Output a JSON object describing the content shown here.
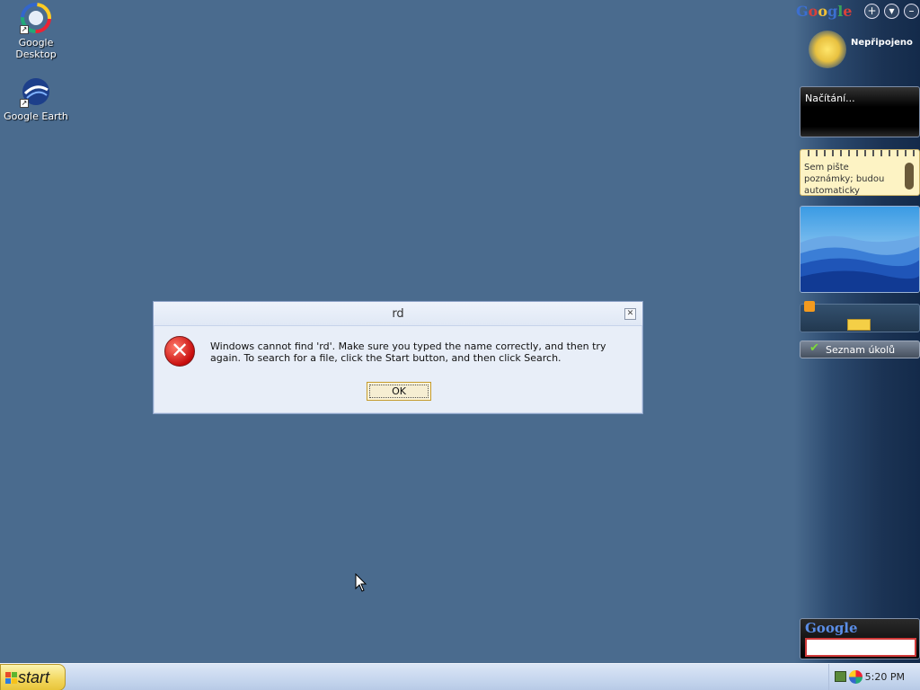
{
  "desktop": {
    "icons": [
      {
        "label_line1": "Google",
        "label_line2": "Desktop",
        "icon": "google-desktop-icon"
      },
      {
        "label_line1": "Google Earth",
        "label_line2": "",
        "icon": "google-earth-icon"
      }
    ]
  },
  "sidebar": {
    "logo": {
      "G": "G",
      "o1": "o",
      "o2": "o",
      "g": "g",
      "l": "l",
      "e": "e"
    },
    "weather": {
      "status": "Nepřipojeno",
      "icon": "sun-icon"
    },
    "news": {
      "text": "Načítání..."
    },
    "notes": {
      "placeholder": "Sem pište poznámky; budou automaticky ukládány."
    },
    "photo": {
      "icon": "mountain-photo"
    },
    "rss": {
      "icon": "rss-icon"
    },
    "todo": {
      "label": "Seznam úkolů",
      "icon": "checkmark-icon"
    },
    "search": {
      "logo_text": "Google",
      "value": ""
    }
  },
  "dialog": {
    "title": "rd",
    "message": "Windows cannot find 'rd'. Make sure you typed the name correctly, and then try again. To search for a file, click the Start button, and then click Search.",
    "ok_label": "OK",
    "icon": "error-icon"
  },
  "taskbar": {
    "start_label": "start",
    "clock": "5:20 PM"
  },
  "colors": {
    "desktop_bg": "#4a6b8e",
    "taskbar_bg": "#c6d6ee",
    "start_bg": "#f2d65c",
    "error_red": "#c80d0d"
  }
}
